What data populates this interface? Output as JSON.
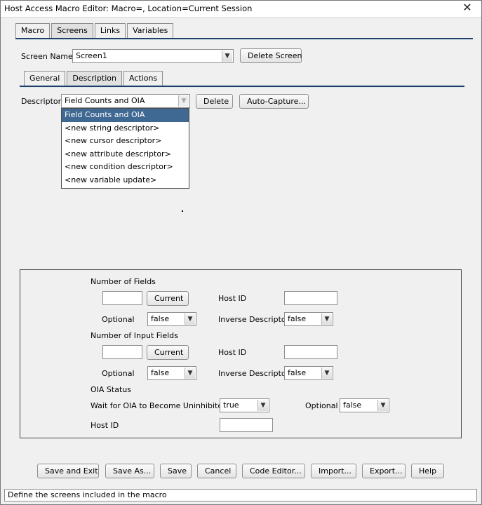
{
  "window": {
    "title": "Host Access Macro Editor:  Macro=, Location=Current Session",
    "close_glyph": "✕"
  },
  "main_tabs": [
    {
      "label": "Macro",
      "selected": false
    },
    {
      "label": "Screens",
      "selected": true
    },
    {
      "label": "Links",
      "selected": false
    },
    {
      "label": "Variables",
      "selected": false
    }
  ],
  "screen_name": {
    "label": "Screen Name",
    "value": "Screen1",
    "delete_label": "Delete Screen"
  },
  "sub_tabs": [
    {
      "label": "General",
      "selected": false
    },
    {
      "label": "Description",
      "selected": true
    },
    {
      "label": "Actions",
      "selected": false
    }
  ],
  "descriptor": {
    "label": "Descriptor",
    "value": "Field Counts and OIA",
    "delete_label": "Delete",
    "autocapture_label": "Auto-Capture...",
    "options": [
      "Field Counts and OIA",
      "<new string descriptor>",
      "<new cursor descriptor>",
      "<new attribute descriptor>",
      "<new condition descriptor>",
      "<new variable update>"
    ],
    "selected_index": 0
  },
  "panel": {
    "num_fields": {
      "heading": "Number of Fields",
      "value": "",
      "current_label": "Current",
      "host_id_label": "Host ID",
      "host_id_value": "",
      "optional_label": "Optional",
      "optional_value": "false",
      "inverse_label": "Inverse Descriptor",
      "inverse_value": "false"
    },
    "num_input_fields": {
      "heading": "Number of Input Fields",
      "value": "",
      "current_label": "Current",
      "host_id_label": "Host ID",
      "host_id_value": "",
      "optional_label": "Optional",
      "optional_value": "false",
      "inverse_label": "Inverse Descriptor",
      "inverse_value": "false"
    },
    "oia": {
      "heading": "OIA Status",
      "wait_label": "Wait for OIA to Become Uninhibited",
      "wait_value": "true",
      "optional_label": "Optional",
      "optional_value": "false",
      "host_id_label": "Host ID",
      "host_id_value": ""
    }
  },
  "bottom_buttons": {
    "save_exit": "Save and Exit",
    "save_as": "Save As...",
    "save": "Save",
    "cancel": "Cancel",
    "code_editor": "Code Editor...",
    "import": "Import...",
    "export": "Export...",
    "help": "Help"
  },
  "status_text": "Define the screens included in the macro",
  "icons": {
    "dropdown_arrow": "▼"
  }
}
